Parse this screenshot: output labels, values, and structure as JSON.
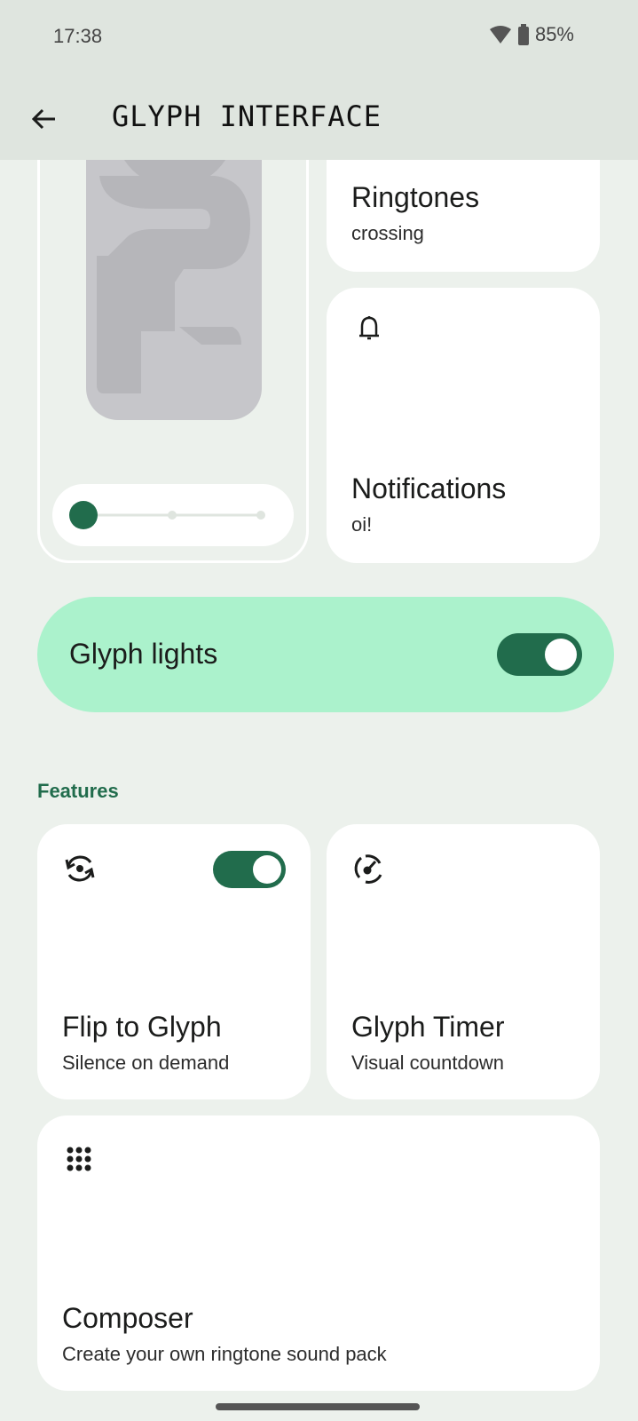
{
  "status_bar": {
    "time": "17:38",
    "battery": "85%",
    "wifi_icon": "wifi-icon",
    "battery_icon": "battery-icon"
  },
  "app_bar": {
    "title": "GLYPH INTERFACE",
    "back_icon": "arrow-back-icon"
  },
  "preview": {
    "steps": 3,
    "selected_step": 1
  },
  "ringtones": {
    "title": "Ringtones",
    "subtitle": "crossing"
  },
  "notifications": {
    "title": "Notifications",
    "subtitle": "oi!",
    "icon": "bell-icon"
  },
  "glyph_lights": {
    "label": "Glyph lights",
    "enabled": true
  },
  "features": {
    "heading": "Features",
    "items": [
      {
        "title": "Flip to Glyph",
        "subtitle": "Silence on demand",
        "icon": "flip-rotate-icon",
        "toggle": true
      },
      {
        "title": "Glyph Timer",
        "subtitle": "Visual countdown",
        "icon": "timer-icon"
      },
      {
        "title": "Composer",
        "subtitle": "Create your own ringtone sound pack",
        "icon": "dot-grid-icon"
      }
    ]
  },
  "colors": {
    "accent": "#216c4c",
    "highlight": "#abf2cc",
    "background": "#ecf1ec",
    "bar": "#dfe5df"
  }
}
